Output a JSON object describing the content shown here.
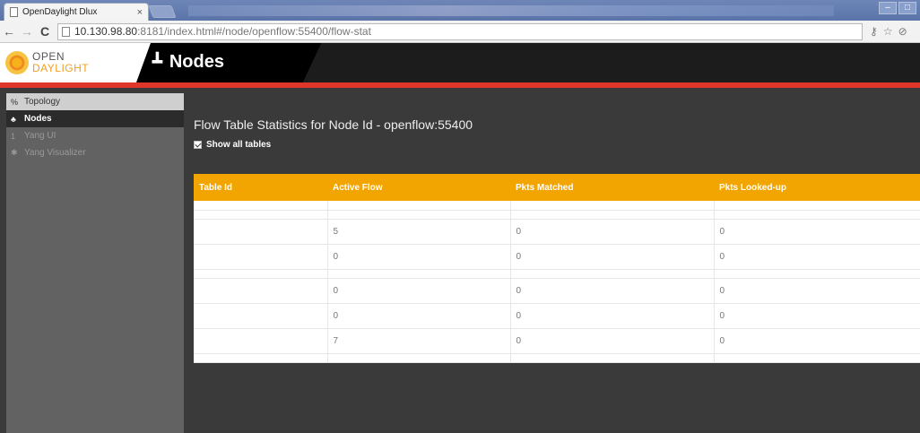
{
  "browser": {
    "tab_title": "OpenDaylight Dlux",
    "tab_close": "×",
    "url_host": "10.130.98.80",
    "url_path": ":8181/index.html#/node/openflow:55400/flow-stat"
  },
  "logo": {
    "line1": "OPEN",
    "line2": "DAYLIGHT"
  },
  "header": {
    "title": "Nodes"
  },
  "sidebar": {
    "items": [
      {
        "label": "Topology",
        "icon": "topology-icon"
      },
      {
        "label": "Nodes",
        "icon": "nodes-icon"
      },
      {
        "label": "Yang UI",
        "icon": "yang-ui-icon"
      },
      {
        "label": "Yang Visualizer",
        "icon": "yang-visualizer-icon"
      }
    ]
  },
  "main": {
    "title": "Flow Table Statistics for Node Id - openflow:55400",
    "show_all_label": "Show all tables",
    "show_all_checked": true,
    "table": {
      "columns": [
        "Table Id",
        "Active Flow",
        "Pkts Matched",
        "Pkts Looked-up"
      ],
      "rows": [
        [
          "",
          "",
          "",
          ""
        ],
        [
          "",
          "",
          "",
          ""
        ],
        [
          "",
          "5",
          "0",
          "0"
        ],
        [
          "",
          "0",
          "0",
          "0"
        ],
        [
          "",
          "",
          "",
          ""
        ],
        [
          "",
          "0",
          "0",
          "0"
        ],
        [
          "",
          "0",
          "0",
          "0"
        ],
        [
          "",
          "7",
          "0",
          "0"
        ],
        [
          "",
          "",
          "",
          ""
        ]
      ]
    }
  },
  "colors": {
    "accent": "#f2a400",
    "brand_red": "#e0362a"
  }
}
